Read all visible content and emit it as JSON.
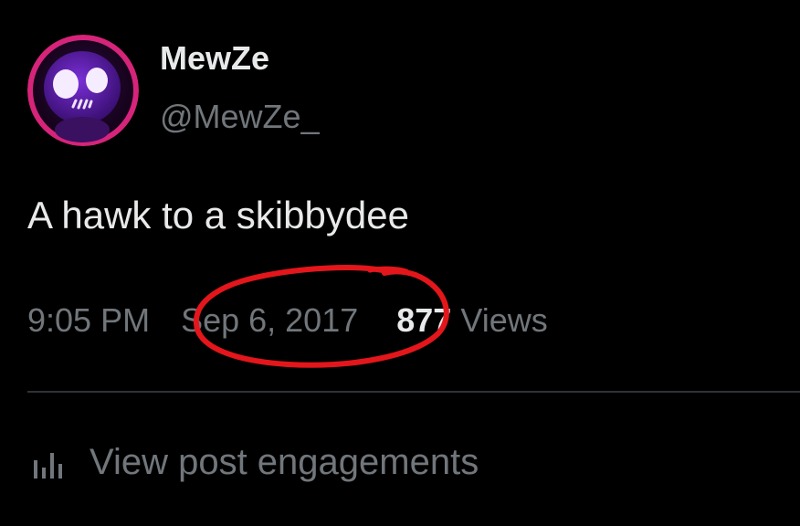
{
  "author": {
    "display_name": "MewZe",
    "handle": "@MewZe_"
  },
  "post": {
    "text": "A hawk to a skibbydee"
  },
  "meta": {
    "time": "9:05 PM",
    "date": "Sep 6, 2017",
    "views_count": "877",
    "views_label": "Views"
  },
  "engagements": {
    "label": "View post engagements",
    "icon": "bar-chart-icon"
  },
  "annotation": {
    "type": "hand-drawn red circle around date",
    "color": "#e3161b"
  },
  "colors": {
    "background": "#000000",
    "primary_text": "#e7e9ea",
    "secondary_text": "#71767b",
    "divider": "#2f3336",
    "avatar_ring": "#d6247a"
  }
}
